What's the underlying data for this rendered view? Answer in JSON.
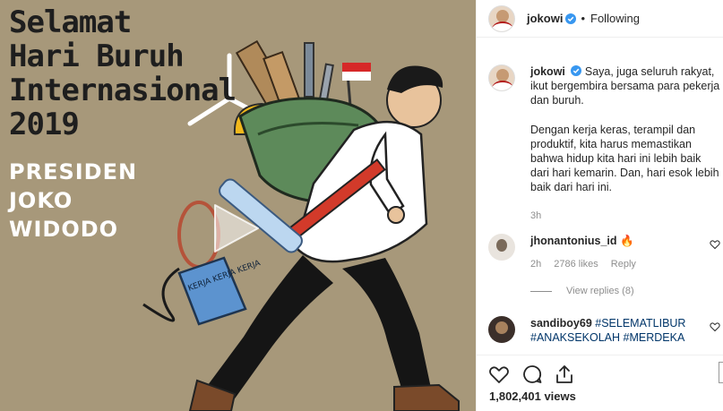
{
  "media": {
    "title_lines": [
      "Selamat",
      "Hari Buruh",
      "Internasional",
      "2019"
    ],
    "subtitle_lines": [
      "PRESIDEN",
      "JOKO WIDODO"
    ],
    "bag_text": "KERJA KERJA KERJA"
  },
  "header": {
    "username": "jokowi",
    "separator": "•",
    "follow_state": "Following"
  },
  "caption": {
    "username": "jokowi",
    "paragraph1": "Saya, juga seluruh rakyat, ikut bergembira bersama para pekerja dan buruh.",
    "paragraph2": "Dengan kerja keras, terampil dan produktif, kita harus memastikan bahwa hidup kita hari ini lebih baik dari hari kemarin. Dan, hari esok lebih baik dari hari ini.",
    "time": "3h"
  },
  "comments": [
    {
      "username": "jhonantonius_id",
      "text": "🔥",
      "time": "2h",
      "likes": "2786 likes",
      "reply_label": "Reply",
      "view_replies": "View replies (8)"
    },
    {
      "username": "sandiboy69",
      "text": "#SELEMATLIBUR #ANAKSEKOLAH #MERDEKA"
    }
  ],
  "actions": {
    "views": "1,802,401 views",
    "icons": [
      "heart-icon",
      "comment-icon",
      "share-icon"
    ]
  },
  "colors": {
    "media_bg": "#a7987a",
    "verified": "#3897f0",
    "hashtag": "#003569",
    "muted": "#8e8e8e"
  }
}
